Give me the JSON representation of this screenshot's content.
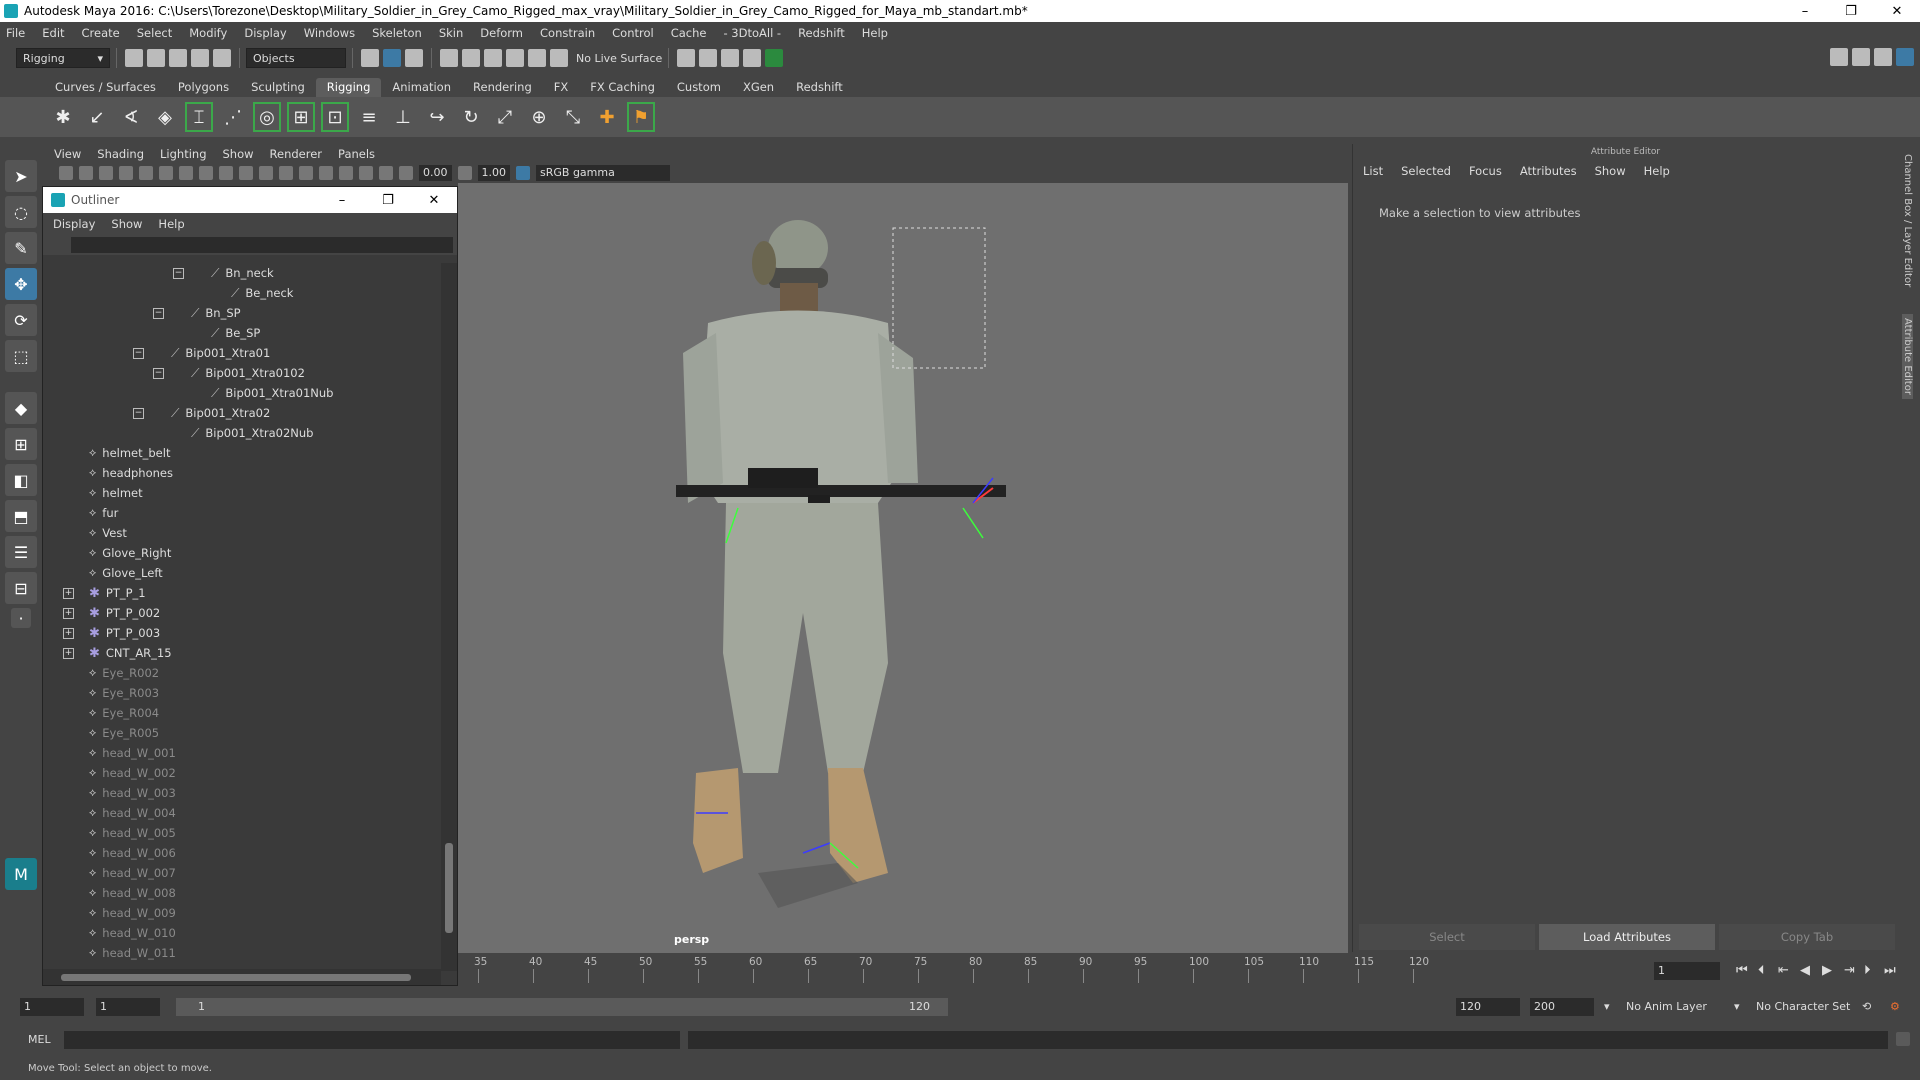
{
  "window": {
    "title": "Autodesk Maya 2016: C:\\Users\\Torezone\\Desktop\\Military_Soldier_in_Grey_Camo_Rigged_max_vray\\Military_Soldier_in_Grey_Camo_Rigged_for_Maya_mb_standart.mb*",
    "minimize": "–",
    "maximize": "❐",
    "close": "✕"
  },
  "menubar": [
    "File",
    "Edit",
    "Create",
    "Select",
    "Modify",
    "Display",
    "Windows",
    "Skeleton",
    "Skin",
    "Deform",
    "Constrain",
    "Control",
    "Cache",
    "- 3DtoAll -",
    "Redshift",
    "Help"
  ],
  "statusline": {
    "mode": "Rigging",
    "selection_mode": "Objects",
    "live_surface": "No Live Surface"
  },
  "shelf_tabs": {
    "items": [
      "Curves / Surfaces",
      "Polygons",
      "Sculpting",
      "Rigging",
      "Animation",
      "Rendering",
      "FX",
      "FX Caching",
      "Custom",
      "XGen",
      "Redshift"
    ],
    "active": "Rigging"
  },
  "panel_menu": [
    "View",
    "Shading",
    "Lighting",
    "Show",
    "Renderer",
    "Panels"
  ],
  "viewbar": {
    "exposure": "0.00",
    "gamma": "1.00",
    "color_space": "sRGB gamma"
  },
  "viewport": {
    "camera": "persp"
  },
  "outliner": {
    "title": "Outliner",
    "menu": [
      "Display",
      "Show",
      "Help"
    ],
    "rows": [
      {
        "label": "Bn_neck",
        "indent": 168,
        "icon": "bone",
        "exp": "−",
        "expx": 130
      },
      {
        "label": "Be_neck",
        "indent": 188,
        "icon": "bone"
      },
      {
        "label": "Bn_SP",
        "indent": 148,
        "icon": "bone",
        "exp": "−",
        "expx": 110
      },
      {
        "label": "Be_SP",
        "indent": 168,
        "icon": "bone"
      },
      {
        "label": "Bip001_Xtra01",
        "indent": 128,
        "icon": "bone",
        "exp": "−",
        "expx": 90
      },
      {
        "label": "Bip001_Xtra0102",
        "indent": 148,
        "icon": "bone",
        "exp": "−",
        "expx": 110
      },
      {
        "label": "Bip001_Xtra01Nub",
        "indent": 168,
        "icon": "bone"
      },
      {
        "label": "Bip001_Xtra02",
        "indent": 128,
        "icon": "bone",
        "exp": "−",
        "expx": 90
      },
      {
        "label": "Bip001_Xtra02Nub",
        "indent": 148,
        "icon": "bone"
      },
      {
        "label": "helmet_belt",
        "indent": 46,
        "icon": "mesh"
      },
      {
        "label": "headphones",
        "indent": 46,
        "icon": "mesh"
      },
      {
        "label": "helmet",
        "indent": 46,
        "icon": "mesh"
      },
      {
        "label": "fur",
        "indent": 46,
        "icon": "mesh"
      },
      {
        "label": "Vest",
        "indent": 46,
        "icon": "mesh"
      },
      {
        "label": "Glove_Right",
        "indent": 46,
        "icon": "mesh"
      },
      {
        "label": "Glove_Left",
        "indent": 46,
        "icon": "mesh"
      },
      {
        "label": "PT_P_1",
        "indent": 46,
        "icon": "star",
        "exp": "+",
        "expx": 20
      },
      {
        "label": "PT_P_002",
        "indent": 46,
        "icon": "star",
        "exp": "+",
        "expx": 20
      },
      {
        "label": "PT_P_003",
        "indent": 46,
        "icon": "star",
        "exp": "+",
        "expx": 20
      },
      {
        "label": "CNT_AR_15",
        "indent": 46,
        "icon": "star",
        "exp": "+",
        "expx": 20
      },
      {
        "label": "Eye_R002",
        "indent": 46,
        "icon": "mesh",
        "dim": true
      },
      {
        "label": "Eye_R003",
        "indent": 46,
        "icon": "mesh",
        "dim": true
      },
      {
        "label": "Eye_R004",
        "indent": 46,
        "icon": "mesh",
        "dim": true
      },
      {
        "label": "Eye_R005",
        "indent": 46,
        "icon": "mesh",
        "dim": true
      },
      {
        "label": "head_W_001",
        "indent": 46,
        "icon": "mesh",
        "dim": true
      },
      {
        "label": "head_W_002",
        "indent": 46,
        "icon": "mesh",
        "dim": true
      },
      {
        "label": "head_W_003",
        "indent": 46,
        "icon": "mesh",
        "dim": true
      },
      {
        "label": "head_W_004",
        "indent": 46,
        "icon": "mesh",
        "dim": true
      },
      {
        "label": "head_W_005",
        "indent": 46,
        "icon": "mesh",
        "dim": true
      },
      {
        "label": "head_W_006",
        "indent": 46,
        "icon": "mesh",
        "dim": true
      },
      {
        "label": "head_W_007",
        "indent": 46,
        "icon": "mesh",
        "dim": true
      },
      {
        "label": "head_W_008",
        "indent": 46,
        "icon": "mesh",
        "dim": true
      },
      {
        "label": "head_W_009",
        "indent": 46,
        "icon": "mesh",
        "dim": true
      },
      {
        "label": "head_W_010",
        "indent": 46,
        "icon": "mesh",
        "dim": true
      },
      {
        "label": "head_W_011",
        "indent": 46,
        "icon": "mesh",
        "dim": true
      }
    ]
  },
  "attribute_editor": {
    "header": "Attribute Editor",
    "menu": [
      "List",
      "Selected",
      "Focus",
      "Attributes",
      "Show",
      "Help"
    ],
    "message": "Make a selection to view attributes",
    "buttons": [
      "Select",
      "Load Attributes",
      "Copy Tab"
    ],
    "side_tabs": [
      "Channel Box / Layer Editor",
      "Attribute Editor"
    ]
  },
  "timeline": {
    "ticks": [
      "35",
      "40",
      "45",
      "50",
      "55",
      "60",
      "65",
      "70",
      "75",
      "80",
      "85",
      "90",
      "95",
      "100",
      "105",
      "110",
      "115",
      "120"
    ],
    "current_frame": "1"
  },
  "range": {
    "start": "1",
    "playback_start": "1",
    "slider_start": "1",
    "slider_end": "120",
    "playback_end": "120",
    "end": "200",
    "anim_layer": "No Anim Layer",
    "character_set": "No Character Set"
  },
  "command": {
    "label": "MEL"
  },
  "help_line": "Move Tool: Select an object to move.",
  "colors": {
    "accent": "#3d7aa5",
    "viewport": "#6f6f6f",
    "panel": "#444444"
  }
}
